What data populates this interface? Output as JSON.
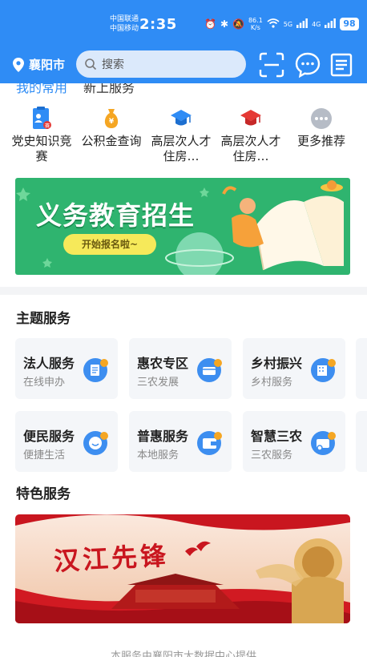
{
  "status_bar": {
    "carrier1": "中国联通",
    "carrier2": "中国移动",
    "time": "2:35",
    "speed_value": "86.1",
    "speed_unit": "K/s",
    "network1": "5G",
    "network2": "4G",
    "battery": "98"
  },
  "header": {
    "location": "襄阳市",
    "search_placeholder": "搜索"
  },
  "tabs": [
    "我的常用",
    "新上服务"
  ],
  "quick_services": [
    {
      "label": "党史知识竞赛",
      "icon": "quiz-icon"
    },
    {
      "label": "公积金查询",
      "icon": "money-bag-icon"
    },
    {
      "label": "高层次人才住房…",
      "icon": "graduation-cap-icon"
    },
    {
      "label": "高层次人才住房…",
      "icon": "graduation-cap-icon"
    },
    {
      "label": "更多推荐",
      "icon": "more-icon"
    }
  ],
  "banner": {
    "title": "义务教育招生",
    "button": "开始报名啦~"
  },
  "themed": {
    "title": "主题服务",
    "cards": [
      {
        "title": "法人服务",
        "subtitle": "在线申办",
        "icon": "legal-person-icon"
      },
      {
        "title": "惠农专区",
        "subtitle": "三农发展",
        "icon": "agriculture-icon"
      },
      {
        "title": "乡村振兴",
        "subtitle": "乡村服务",
        "icon": "village-icon"
      },
      {
        "title": "便民服务",
        "subtitle": "便捷生活",
        "icon": "convenience-icon"
      },
      {
        "title": "普惠服务",
        "subtitle": "本地服务",
        "icon": "wallet-icon"
      },
      {
        "title": "智慧三农",
        "subtitle": "三农服务",
        "icon": "smart-farm-icon"
      }
    ]
  },
  "featured": {
    "title": "特色服务",
    "banner_title": "汉江先锋"
  },
  "footer": "本服务由襄阳市大数据中心提供",
  "colors": {
    "brand_blue": "#2f8cf5",
    "banner_green": "#2fb46f",
    "feature_red": "#c9161f"
  }
}
